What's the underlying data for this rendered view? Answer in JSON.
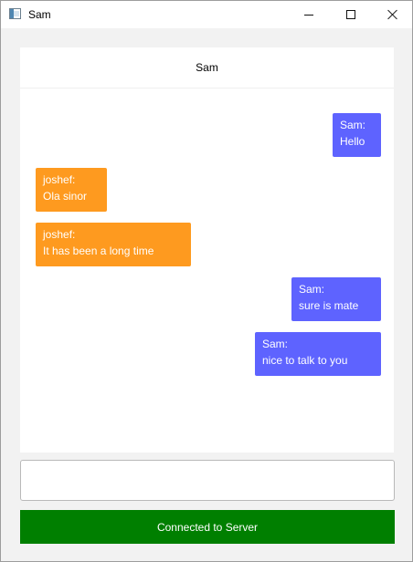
{
  "window": {
    "title": "Sam",
    "app_icon": "java-app-icon",
    "controls": [
      "minimize",
      "maximize",
      "close"
    ]
  },
  "chat": {
    "header_name": "Sam",
    "messages": [
      {
        "direction": "outgoing",
        "sender": "Sam:",
        "text": "Hello"
      },
      {
        "direction": "incoming",
        "sender": "joshef:",
        "text": "Ola sinor"
      },
      {
        "direction": "incoming",
        "sender": "joshef:",
        "text": "It has been a long time"
      },
      {
        "direction": "outgoing",
        "sender": "Sam:",
        "text": "sure is mate"
      },
      {
        "direction": "outgoing",
        "sender": "Sam:",
        "text": "nice to talk to you"
      }
    ]
  },
  "input": {
    "value": "",
    "placeholder": ""
  },
  "status": {
    "label": "Connected to Server"
  },
  "colors": {
    "outgoing_bubble": "#5e63ff",
    "incoming_bubble": "#fe9a1f",
    "status_bar": "#007f00"
  }
}
